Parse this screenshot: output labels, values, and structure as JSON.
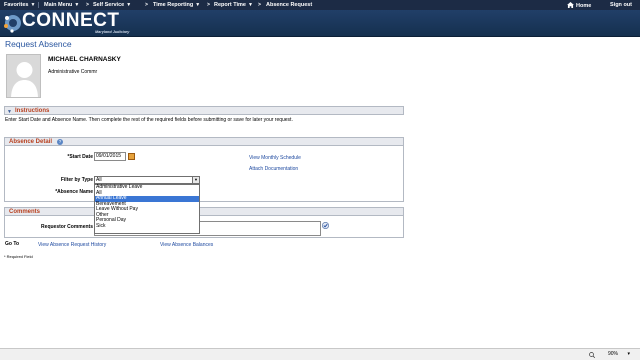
{
  "nav": {
    "items": [
      {
        "label": "Favorites",
        "caret": "▼"
      },
      {
        "label": "Main Menu",
        "caret": "▼"
      },
      {
        "label": "Self Service",
        "caret": "▼"
      },
      {
        "label": "Time Reporting",
        "caret": "▼"
      },
      {
        "label": "Report Time",
        "caret": "▼"
      },
      {
        "label": "Absence Request",
        "caret": ""
      }
    ],
    "separator": ">",
    "home": "Home",
    "signout": "Sign out",
    "home_icon": "house-icon"
  },
  "brand": {
    "name": "CONNECT",
    "subtitle": "Maryland Judiciary"
  },
  "page": {
    "title": "Request Absence"
  },
  "employee": {
    "name": "MICHAEL CHARNASKY",
    "title": "Administrative Commr"
  },
  "instructions": {
    "header": "Instructions",
    "text": "Enter Start Date and Absence Name. Then complete the rest of the required fields before submitting or save for later your request."
  },
  "absence_detail": {
    "header": "Absence Detail",
    "start_date_label": "*Start Date",
    "start_date_value": "09/01/2015",
    "filter_label": "Filter by Type",
    "filter_value": "All",
    "filter_options": [
      "Administrative Leave",
      "All",
      "Annual Leave",
      "Bereavement",
      "Leave Without Pay",
      "Other",
      "Personal Day",
      "Sick"
    ],
    "filter_highlighted": "Annual Leave",
    "absence_name_label": "*Absence Name",
    "links": {
      "monthly_schedule": "View Monthly Schedule",
      "attach_documentation": "Attach Documentation"
    }
  },
  "comments": {
    "header": "Comments",
    "requestor_label": "Requestor Comments",
    "value": ""
  },
  "goto": {
    "label": "Go To",
    "history": "View Absence Request History",
    "balances": "View Absence Balances"
  },
  "footnote": "* Required Field",
  "status": {
    "zoom": "90%"
  },
  "colors": {
    "nav_bg": "#1c2b45",
    "banner": "#1a3558",
    "link": "#1f4aa0",
    "section_title": "#b8401f",
    "highlight": "#3a76d4"
  }
}
